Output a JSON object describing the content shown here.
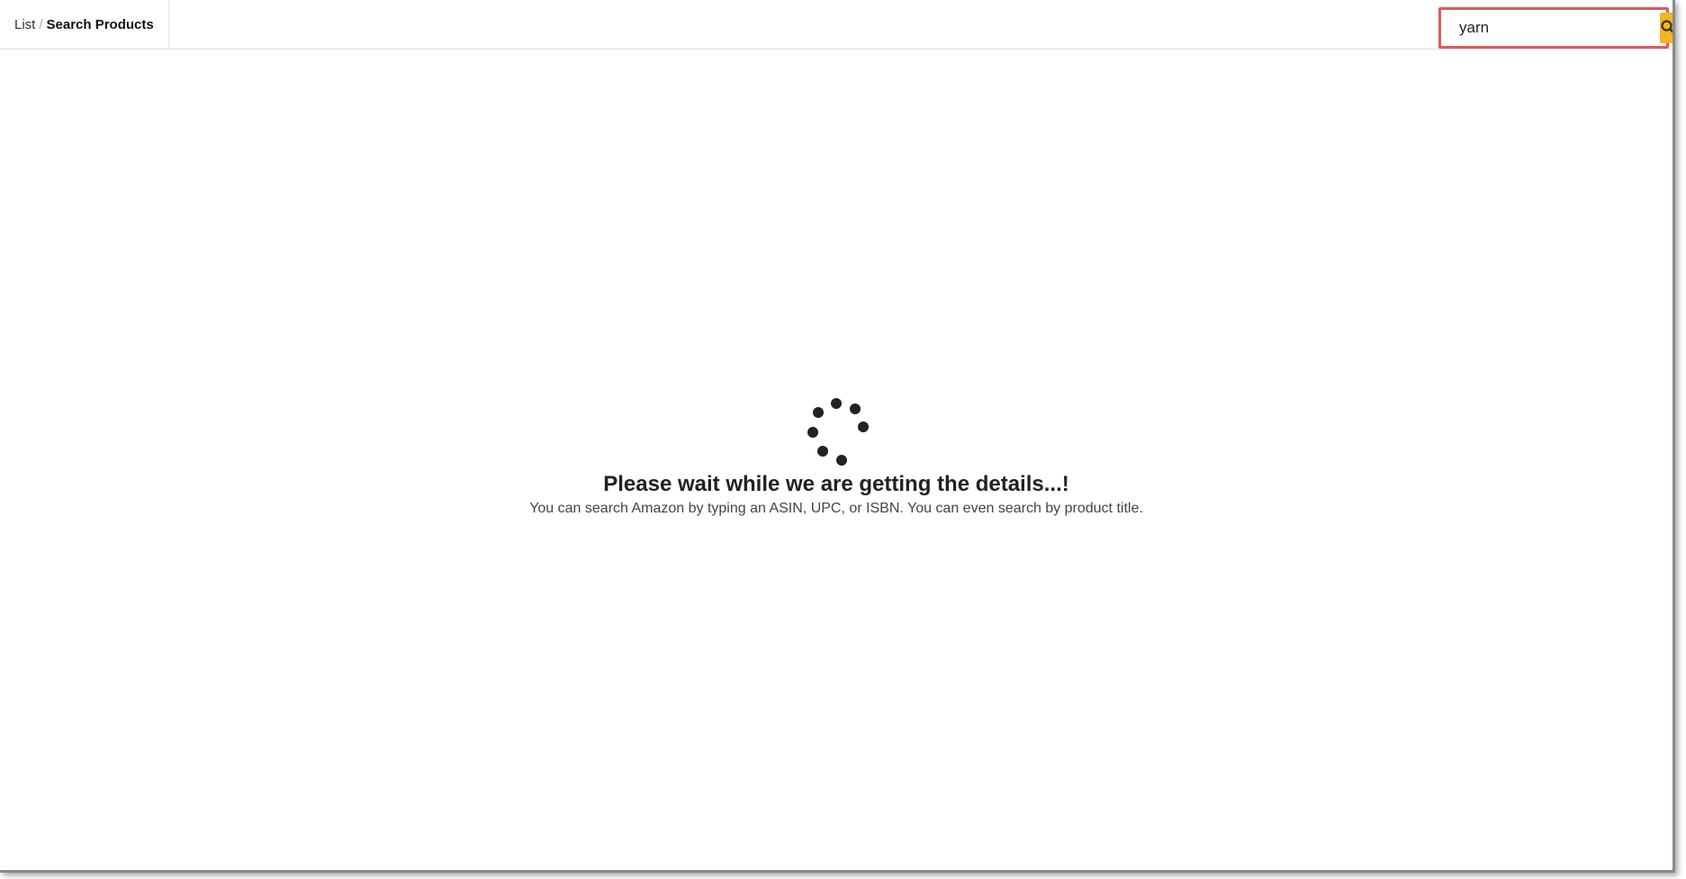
{
  "breadcrumb": {
    "parent": "List",
    "separator": "/",
    "current": "Search Products"
  },
  "search": {
    "value": "yarn",
    "button_icon": "search-icon",
    "accent_color": "#f3b521",
    "highlight_color": "#e05a5a"
  },
  "loading": {
    "spinner_icon": "loading-spinner-icon",
    "title": "Please wait while we are getting the details...!",
    "subtitle": "You can search Amazon by typing an ASIN, UPC, or ISBN. You can even search by product title."
  }
}
